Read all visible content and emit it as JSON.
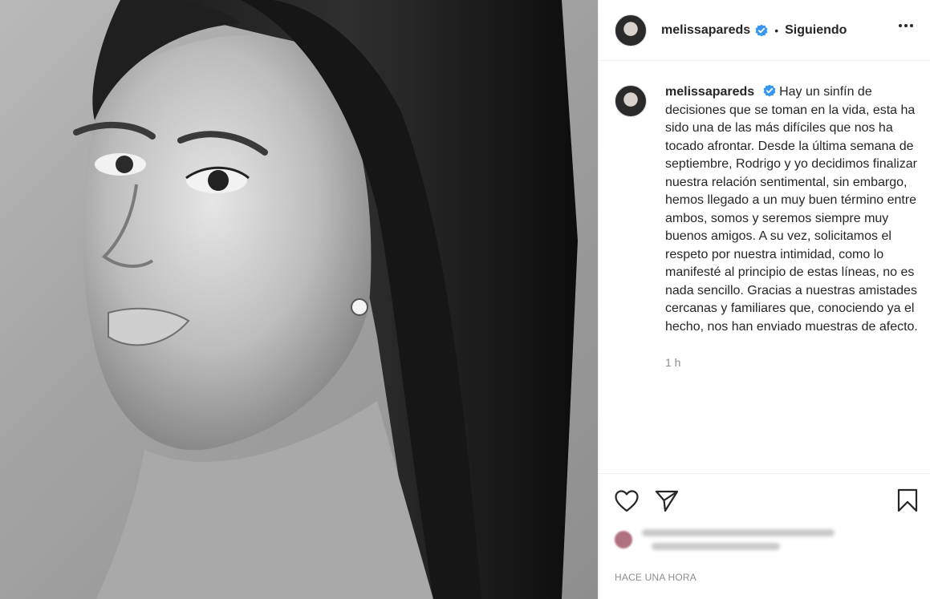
{
  "post": {
    "image_alt": "portrait-photo",
    "author": {
      "username": "melissapareds",
      "verified": true,
      "follow_status": "Siguiendo",
      "separator": "•"
    },
    "caption": "Hay un sinfín de decisiones que se toman en la vida, esta ha sido una de las más difíciles que nos ha tocado afrontar. Desde la última semana de septiembre, Rodrigo y yo decidimos finalizar nuestra relación sentimental, sin embargo, hemos llegado a un muy buen término entre ambos, somos y seremos siempre muy buenos amigos. A su vez, solicitamos el respeto por nuestra intimidad, como lo manifesté al principio de estas líneas, no es nada sencillo. Gracias a nuestras amistades cercanas y familiares que, conociendo ya el hecho, nos han enviado muestras de afecto.",
    "caption_time": "1 h",
    "posted_ago": "HACE UNA HORA"
  },
  "icons": {
    "verified": "verified-badge-icon",
    "more": "more-options-icon",
    "like": "heart-icon",
    "share": "paper-plane-icon",
    "save": "bookmark-icon"
  },
  "colors": {
    "text": "#262626",
    "secondary": "#8e8e8e",
    "verified_blue": "#3897f0",
    "border": "#efefef"
  }
}
